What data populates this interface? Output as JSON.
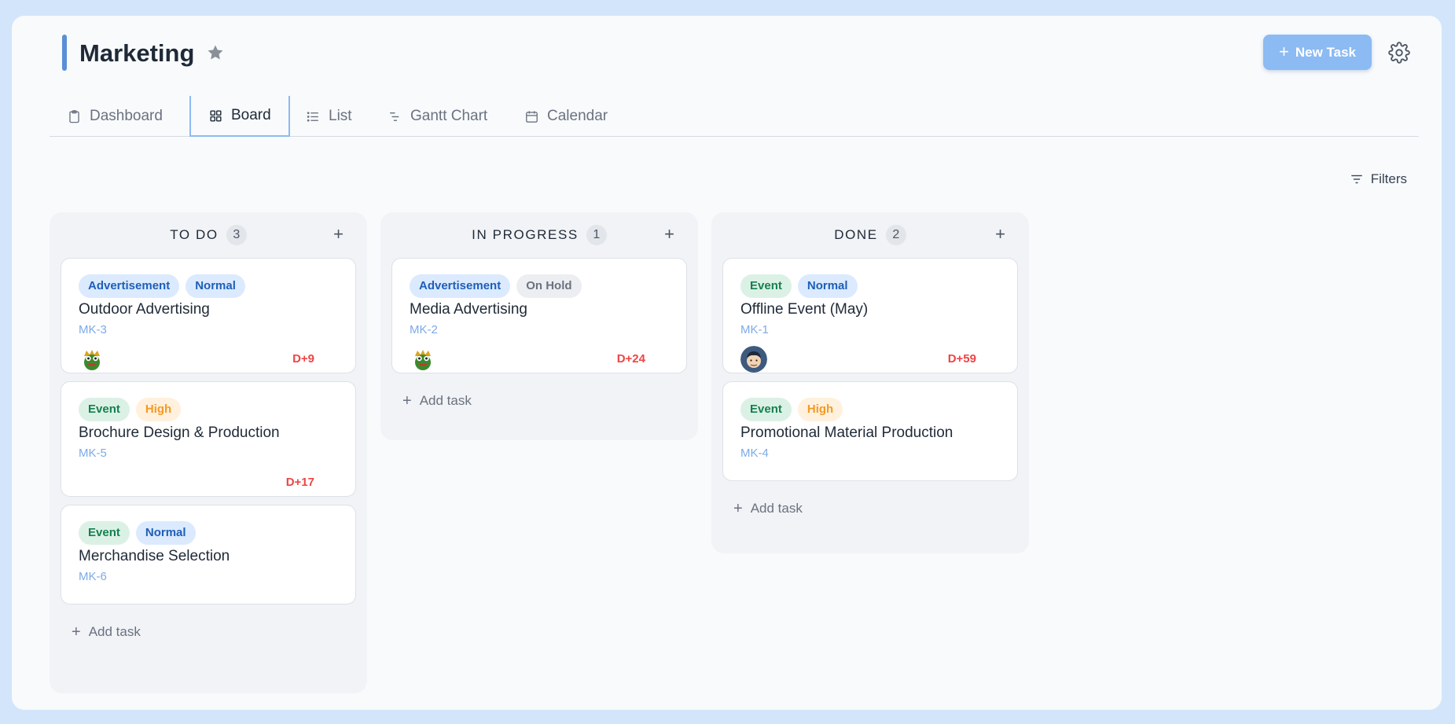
{
  "project": {
    "title": "Marketing"
  },
  "header": {
    "new_task_label": "New Task"
  },
  "tabs": [
    {
      "label": "Dashboard",
      "icon": "clipboard-icon"
    },
    {
      "label": "Board",
      "icon": "grid-icon",
      "active": true
    },
    {
      "label": "List",
      "icon": "list-icon"
    },
    {
      "label": "Gantt Chart",
      "icon": "gantt-icon"
    },
    {
      "label": "Calendar",
      "icon": "calendar-icon"
    }
  ],
  "toolbar": {
    "filters_label": "Filters"
  },
  "add_task_label": "Add task",
  "columns": [
    {
      "title": "TO DO",
      "count": "3",
      "cards": [
        {
          "tags": [
            "Advertisement",
            "Normal"
          ],
          "title": "Outdoor Advertising",
          "id": "MK-3",
          "avatar": "frog",
          "due": "D+9"
        },
        {
          "tags": [
            "Event",
            "High"
          ],
          "title": "Brochure Design & Production",
          "id": "MK-5",
          "avatar": "",
          "due": "D+17"
        },
        {
          "tags": [
            "Event",
            "Normal"
          ],
          "title": "Merchandise Selection",
          "id": "MK-6",
          "avatar": "",
          "due": ""
        }
      ]
    },
    {
      "title": "IN PROGRESS",
      "count": "1",
      "cards": [
        {
          "tags": [
            "Advertisement",
            "On Hold"
          ],
          "title": "Media Advertising",
          "id": "MK-2",
          "avatar": "frog",
          "due": "D+24"
        }
      ]
    },
    {
      "title": "DONE",
      "count": "2",
      "cards": [
        {
          "tags": [
            "Event",
            "Normal"
          ],
          "title": "Offline Event (May)",
          "id": "MK-1",
          "avatar": "man",
          "due": "D+59"
        },
        {
          "tags": [
            "Event",
            "High"
          ],
          "title": "Promotional Material Production",
          "id": "MK-4",
          "avatar": "",
          "due": ""
        }
      ]
    }
  ],
  "colors": {
    "accent": "#8cbaf2",
    "title_bar": "#5b8fd6",
    "due": "#ef4444",
    "tag_blue_bg": "#dbeafe",
    "tag_blue_fg": "#1d5fb8",
    "tag_green_bg": "#dcf1e6",
    "tag_green_fg": "#15804f",
    "tag_orange_bg": "#fff1dd",
    "tag_orange_fg": "#f59a23",
    "tag_gray_bg": "#eceef1",
    "tag_gray_fg": "#6b7280"
  }
}
